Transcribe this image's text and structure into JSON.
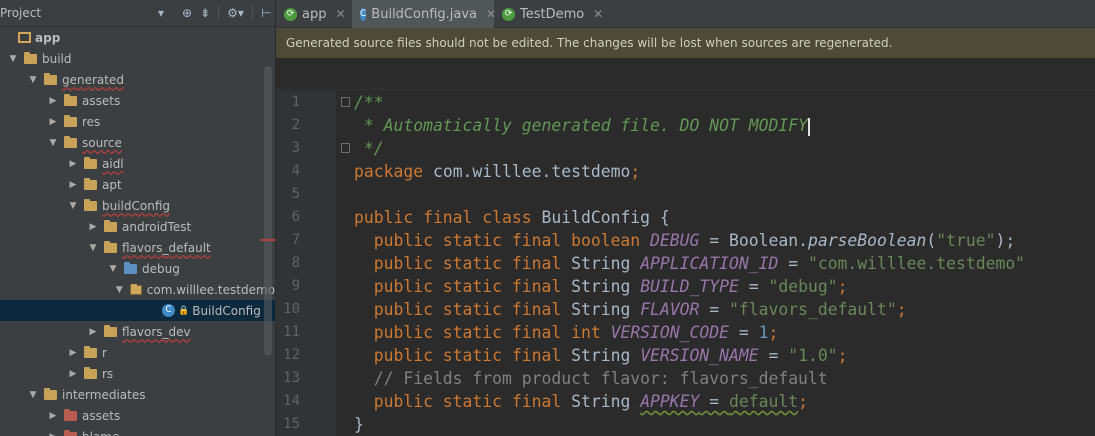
{
  "project_panel": {
    "title": "Project",
    "icons": [
      "target-icon",
      "collapse-icon",
      "gear-icon",
      "hide-panel-icon"
    ],
    "tree": [
      {
        "label": "app",
        "type": "module",
        "depth": 0,
        "arrow": "",
        "bold": true
      },
      {
        "label": "build",
        "type": "folder",
        "depth": 0,
        "arrow": "▼"
      },
      {
        "label": "generated",
        "type": "folder",
        "depth": 1,
        "arrow": "▼",
        "squiggle": true
      },
      {
        "label": "assets",
        "type": "folder",
        "depth": 2,
        "arrow": "▶"
      },
      {
        "label": "res",
        "type": "folder",
        "depth": 2,
        "arrow": "▶"
      },
      {
        "label": "source",
        "type": "folder",
        "depth": 2,
        "arrow": "▼",
        "squiggle": true
      },
      {
        "label": "aidl",
        "type": "folder",
        "depth": 3,
        "arrow": "▶",
        "squiggle": true
      },
      {
        "label": "apt",
        "type": "folder",
        "depth": 3,
        "arrow": "▶"
      },
      {
        "label": "buildConfig",
        "type": "folder",
        "depth": 3,
        "arrow": "▼",
        "squiggle": true
      },
      {
        "label": "androidTest",
        "type": "folder",
        "depth": 4,
        "arrow": "▶"
      },
      {
        "label": "flavors_default",
        "type": "folder",
        "depth": 4,
        "arrow": "▼",
        "squiggle": true
      },
      {
        "label": "debug",
        "type": "source-folder",
        "depth": 5,
        "arrow": "▼"
      },
      {
        "label": "com.willlee.testdemo",
        "type": "package",
        "depth": 6,
        "arrow": "▼"
      },
      {
        "label": "BuildConfig",
        "type": "class",
        "depth": 7,
        "arrow": "",
        "selected": true
      },
      {
        "label": "flavors_dev",
        "type": "folder",
        "depth": 4,
        "arrow": "▶",
        "squiggle": true
      },
      {
        "label": "r",
        "type": "folder",
        "depth": 3,
        "arrow": "▶"
      },
      {
        "label": "rs",
        "type": "folder",
        "depth": 3,
        "arrow": "▶"
      },
      {
        "label": "intermediates",
        "type": "folder",
        "depth": 1,
        "arrow": "▼"
      },
      {
        "label": "assets",
        "type": "folder-red",
        "depth": 2,
        "arrow": "▶"
      },
      {
        "label": "blame",
        "type": "folder-red",
        "depth": 2,
        "arrow": "▶"
      }
    ]
  },
  "tabs": [
    {
      "label": "app",
      "icon": "android-module-icon",
      "active": false
    },
    {
      "label": "BuildConfig.java",
      "icon": "class-icon",
      "active": true
    },
    {
      "label": "TestDemo",
      "icon": "android-module-icon",
      "active": false
    }
  ],
  "banner": "Generated source files should not be edited. The changes will be lost when sources are regenerated.",
  "editor": {
    "line_numbers": [
      "1",
      "2",
      "3",
      "4",
      "5",
      "6",
      "7",
      "8",
      "9",
      "10",
      "11",
      "12",
      "13",
      "14",
      "15"
    ],
    "lines": [
      [
        {
          "t": "/**",
          "c": "doc"
        }
      ],
      [
        {
          "t": " * Automatically generated file. DO NOT MODIFY",
          "c": "doc"
        }
      ],
      [
        {
          "t": " */",
          "c": "doc"
        }
      ],
      [
        {
          "t": "package ",
          "c": "kw"
        },
        {
          "t": "com.willlee.testdemo",
          "c": ""
        },
        {
          "t": ";",
          "c": "kw"
        }
      ],
      [],
      [
        {
          "t": "public final class ",
          "c": "kw"
        },
        {
          "t": "BuildConfig {",
          "c": ""
        }
      ],
      [
        {
          "t": "  public static final boolean ",
          "c": "kw"
        },
        {
          "t": "DEBUG",
          "c": "const"
        },
        {
          "t": " = Boolean.",
          "c": ""
        },
        {
          "t": "parseBoolean",
          "c": "meth"
        },
        {
          "t": "(",
          "c": ""
        },
        {
          "t": "\"true\"",
          "c": "str"
        },
        {
          "t": ");",
          "c": ""
        }
      ],
      [
        {
          "t": "  public static final ",
          "c": "kw"
        },
        {
          "t": "String ",
          "c": ""
        },
        {
          "t": "APPLICATION_ID",
          "c": "const"
        },
        {
          "t": " = ",
          "c": ""
        },
        {
          "t": "\"com.willlee.testdemo\"",
          "c": "str"
        }
      ],
      [
        {
          "t": "  public static final ",
          "c": "kw"
        },
        {
          "t": "String ",
          "c": ""
        },
        {
          "t": "BUILD_TYPE",
          "c": "const"
        },
        {
          "t": " = ",
          "c": ""
        },
        {
          "t": "\"debug\"",
          "c": "str"
        },
        {
          "t": ";",
          "c": "kw"
        }
      ],
      [
        {
          "t": "  public static final ",
          "c": "kw"
        },
        {
          "t": "String ",
          "c": ""
        },
        {
          "t": "FLAVOR",
          "c": "const"
        },
        {
          "t": " = ",
          "c": ""
        },
        {
          "t": "\"flavors_default\"",
          "c": "str"
        },
        {
          "t": ";",
          "c": "kw"
        }
      ],
      [
        {
          "t": "  public static final int ",
          "c": "kw"
        },
        {
          "t": "VERSION_CODE",
          "c": "const"
        },
        {
          "t": " = ",
          "c": ""
        },
        {
          "t": "1",
          "c": "num"
        },
        {
          "t": ";",
          "c": "kw"
        }
      ],
      [
        {
          "t": "  public static final ",
          "c": "kw"
        },
        {
          "t": "String ",
          "c": ""
        },
        {
          "t": "VERSION_NAME",
          "c": "const"
        },
        {
          "t": " = ",
          "c": ""
        },
        {
          "t": "\"1.0\"",
          "c": "str"
        },
        {
          "t": ";",
          "c": "kw"
        }
      ],
      [
        {
          "t": "  // Fields from product flavor: flavors_default",
          "c": "cmt"
        }
      ],
      [
        {
          "t": "  public static final ",
          "c": "kw"
        },
        {
          "t": "String ",
          "c": ""
        },
        {
          "t": "APPKEY",
          "c": "const"
        },
        {
          "t": " = ",
          "c": ""
        },
        {
          "t": "default",
          "c": "str"
        },
        {
          "t": ";",
          "c": "kw"
        }
      ],
      [
        {
          "t": "}",
          "c": ""
        }
      ]
    ]
  }
}
